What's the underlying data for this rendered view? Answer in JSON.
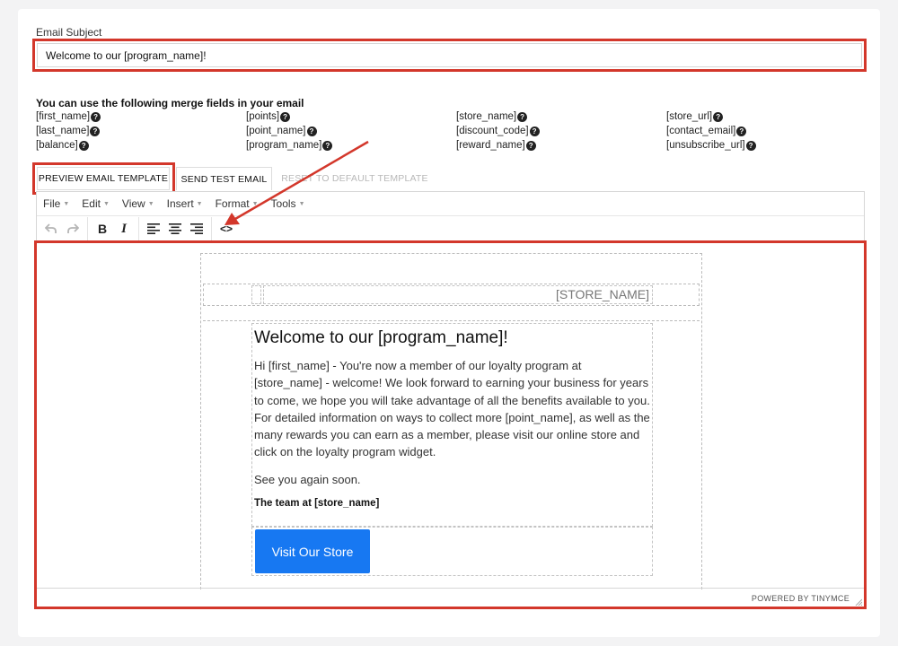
{
  "subject": {
    "label": "Email Subject",
    "value": "Welcome to our [program_name]!"
  },
  "merge": {
    "title": "You can use the following merge fields in your email",
    "fields": [
      "[first_name]",
      "[points]",
      "[store_name]",
      "[store_url]",
      "[last_name]",
      "[point_name]",
      "[discount_code]",
      "[contact_email]",
      "[balance]",
      "[program_name]",
      "[reward_name]",
      "[unsubscribe_url]"
    ],
    "help_glyph": "?"
  },
  "tabs": {
    "preview": "PREVIEW EMAIL TEMPLATE",
    "send": "SEND TEST EMAIL",
    "reset": "RESET TO DEFAULT TEMPLATE"
  },
  "editor": {
    "menu": [
      "File",
      "Edit",
      "View",
      "Insert",
      "Format",
      "Tools"
    ],
    "toolbar_icons": [
      "undo-icon",
      "redo-icon",
      "bold-icon",
      "italic-icon",
      "align-left-icon",
      "align-center-icon",
      "align-right-icon",
      "source-code-icon"
    ],
    "bold_glyph": "B",
    "italic_glyph": "I",
    "code_glyph": "<>",
    "powered_by": "POWERED BY TINYMCE"
  },
  "email": {
    "store_name": "[STORE_NAME]",
    "title": "Welcome to our [program_name]!",
    "paragraph": "Hi [first_name] - You're now a member of our loyalty program at [store_name] - welcome! We look forward to earning your business for years to come, we hope you will take advantage of all the benefits available to you. For detailed information on ways to collect more [point_name], as well as the many rewards you can earn as a member, please visit our online store and click on the loyalty program widget.",
    "closing": "See you again soon.",
    "signature": "The team at [store_name]",
    "button": "Visit Our Store"
  },
  "colors": {
    "highlight": "#d3372b",
    "button": "#1778f2"
  }
}
